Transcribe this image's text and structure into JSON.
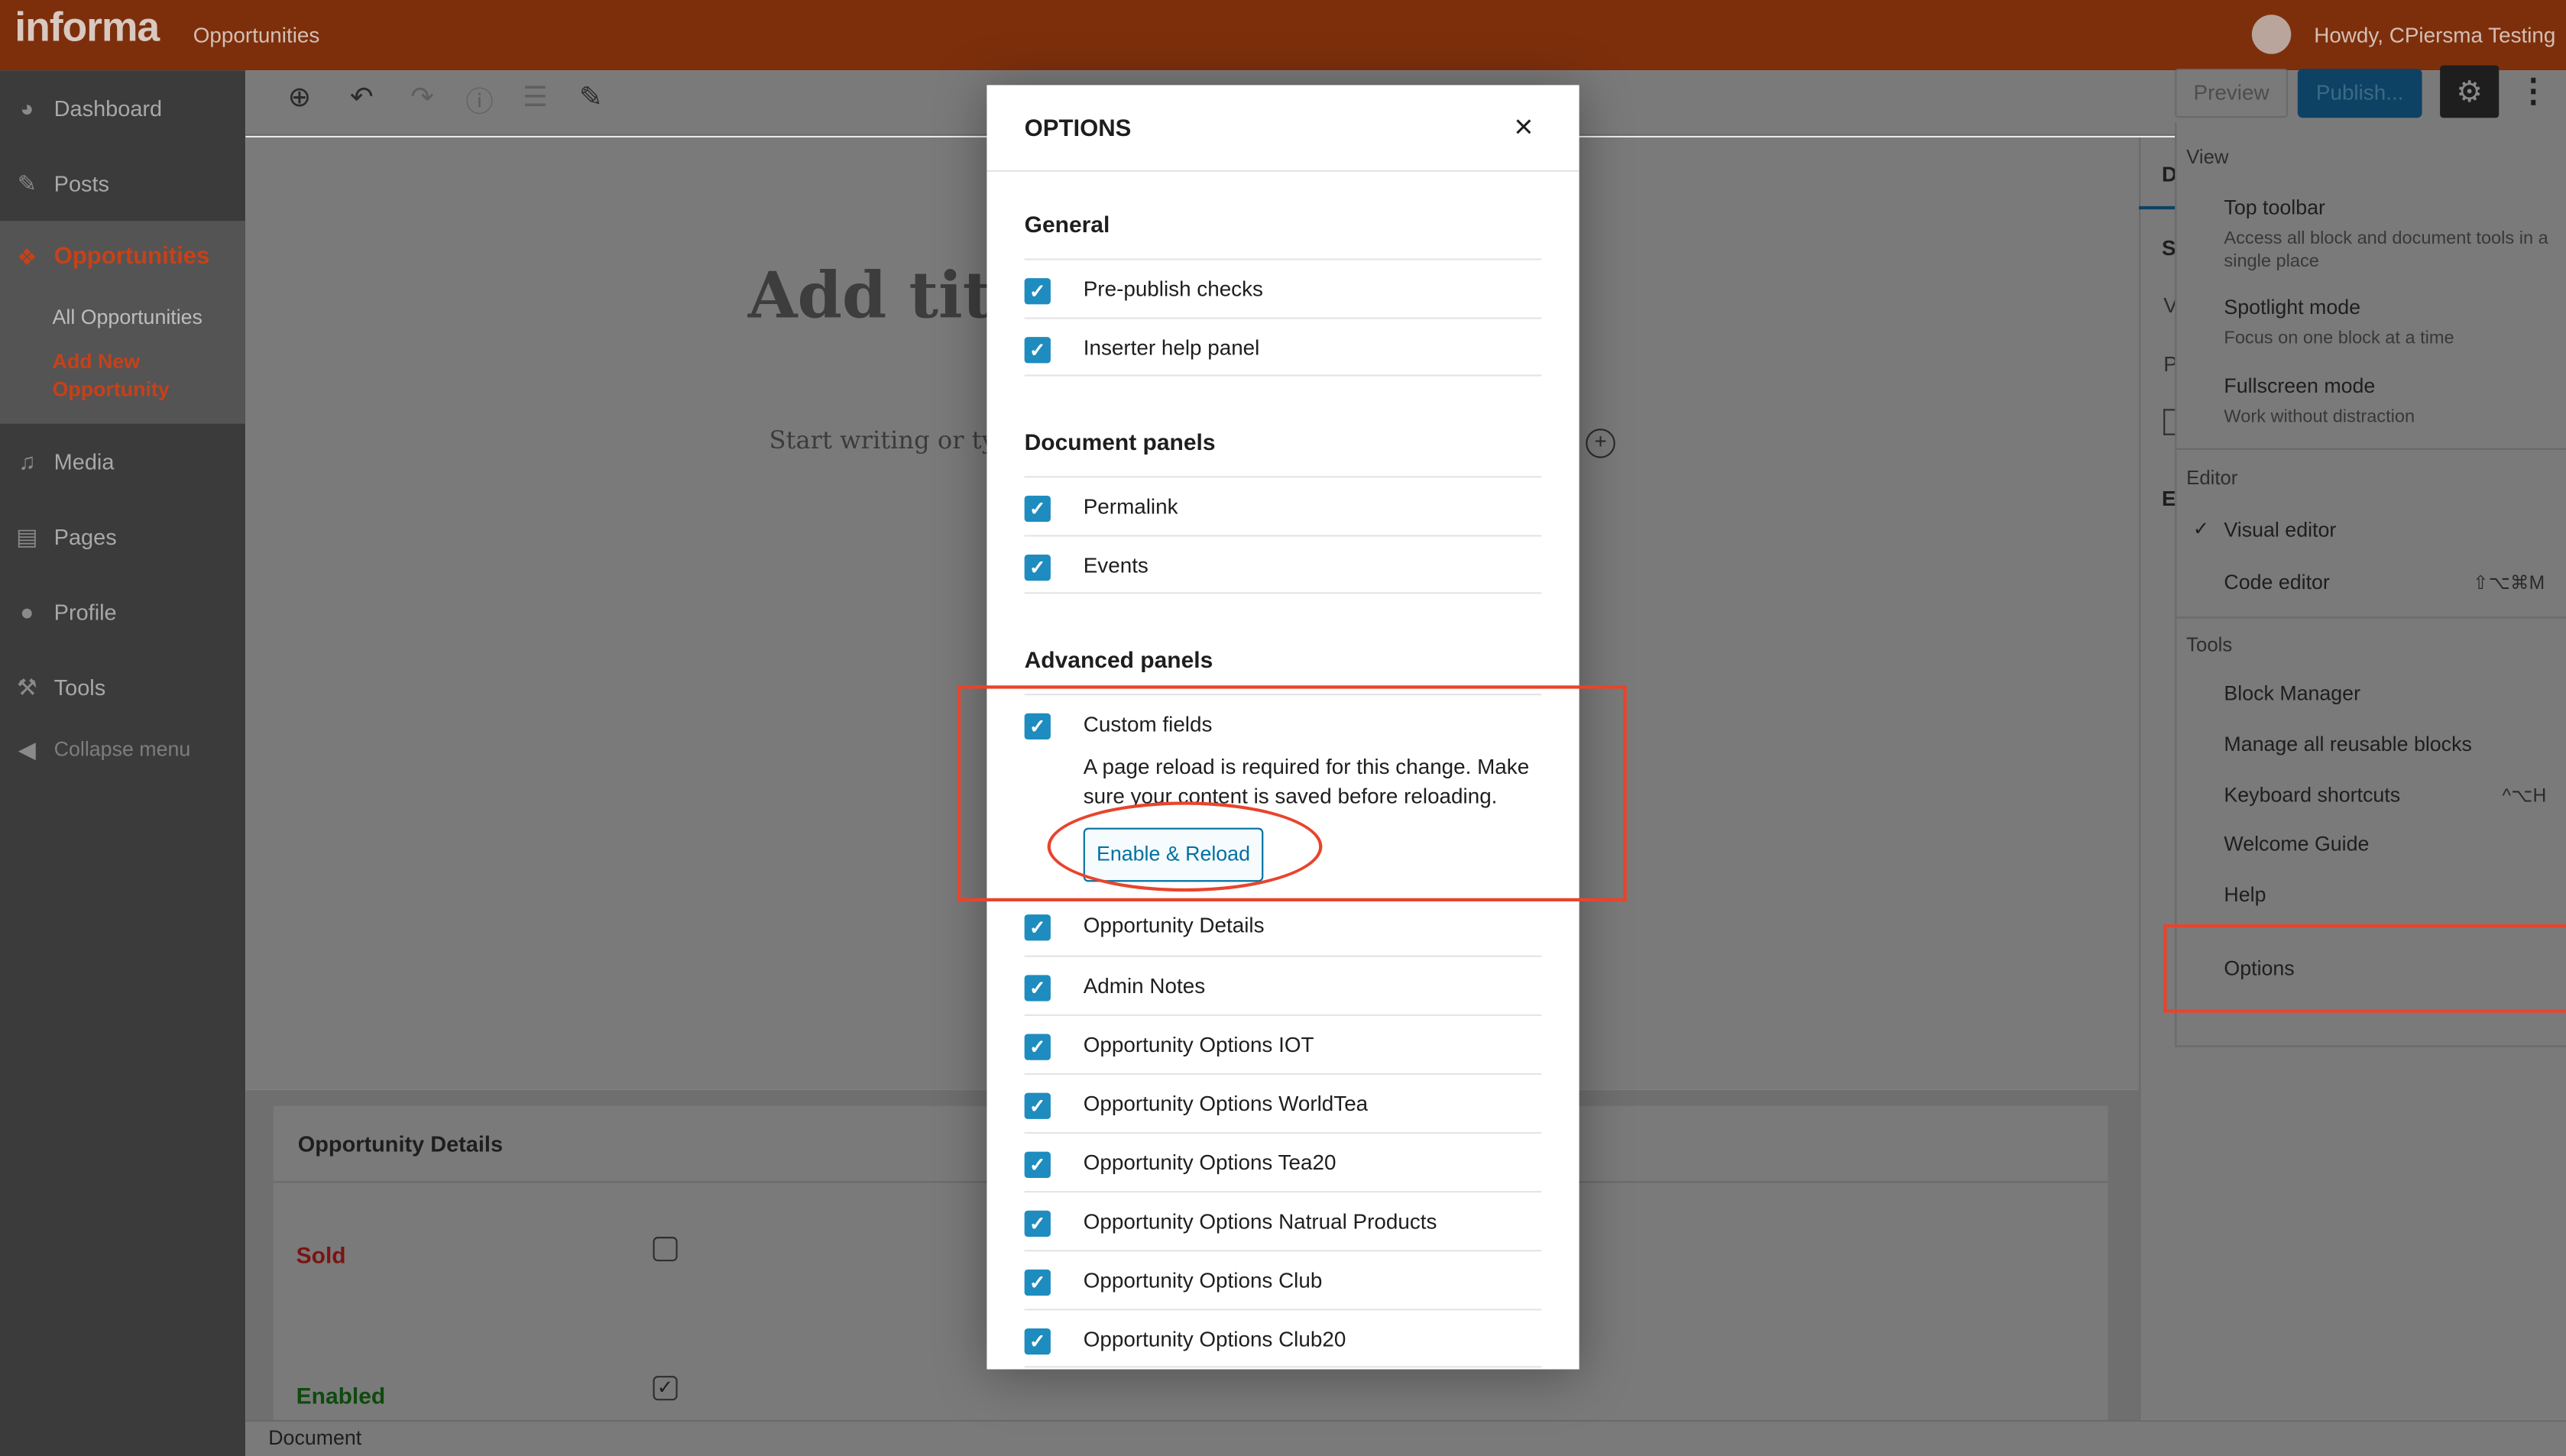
{
  "adminbar": {
    "brand": "informa",
    "site": "Opportunities",
    "howdy": "Howdy, CPiersma Testing"
  },
  "sidebar": {
    "items": [
      {
        "label": "Dashboard",
        "icon": "dashboard-icon"
      },
      {
        "label": "Posts",
        "icon": "pin-icon"
      },
      {
        "label": "Opportunities",
        "icon": "opportunities-icon"
      },
      {
        "label": "Media",
        "icon": "media-icon"
      },
      {
        "label": "Pages",
        "icon": "pages-icon"
      },
      {
        "label": "Profile",
        "icon": "user-icon"
      },
      {
        "label": "Tools",
        "icon": "wrench-icon"
      },
      {
        "label": "Collapse menu",
        "icon": "collapse-icon"
      }
    ],
    "sub": [
      "All Opportunities",
      "Add New Opportunity"
    ]
  },
  "editor": {
    "title_placeholder": "Add title",
    "body_placeholder": "Start writing or type",
    "preview": "Preview",
    "publish": "Publish...",
    "footer": "Document",
    "rp_letters": [
      "D",
      "S",
      "V",
      "P",
      "E"
    ]
  },
  "metabox": {
    "title": "Opportunity Details",
    "sold": "Sold",
    "enabled": "Enabled",
    "sold_checked": false,
    "enabled_checked": true
  },
  "menu": {
    "view_heading": "View",
    "top_toolbar": "Top toolbar",
    "top_toolbar_desc": "Access all block and document tools in a single place",
    "spotlight": "Spotlight mode",
    "spotlight_desc": "Focus on one block at a time",
    "fullscreen": "Fullscreen mode",
    "fullscreen_desc": "Work without distraction",
    "editor_heading": "Editor",
    "visual_editor": "Visual editor",
    "code_editor": "Code editor",
    "code_editor_shortcut": "⇧⌥⌘M",
    "tools_heading": "Tools",
    "block_manager": "Block Manager",
    "reusable": "Manage all reusable blocks",
    "keyboard": "Keyboard shortcuts",
    "keyboard_shortcut": "^⌥H",
    "welcome": "Welcome Guide",
    "help": "Help",
    "options": "Options"
  },
  "modal": {
    "title": "OPTIONS",
    "sections": {
      "general": "General",
      "document": "Document panels",
      "advanced": "Advanced panels"
    },
    "general": [
      "Pre-publish checks",
      "Inserter help panel"
    ],
    "document": [
      "Permalink",
      "Events"
    ],
    "custom_fields": "Custom fields",
    "reload_note": "A page reload is required for this change. Make sure your content is saved before reloading.",
    "enable_reload": "Enable & Reload",
    "advanced": [
      "Opportunity Details",
      "Admin Notes",
      "Opportunity Options IOT",
      "Opportunity Options WorldTea",
      "Opportunity Options Tea20",
      "Opportunity Options Natrual Products",
      "Opportunity Options Club",
      "Opportunity Options Club20"
    ]
  },
  "colors": {
    "accent": "#1e8cbe",
    "brand_bar": "#7d2f0c",
    "highlight": "#e8442c",
    "active_menu": "#c64119"
  }
}
